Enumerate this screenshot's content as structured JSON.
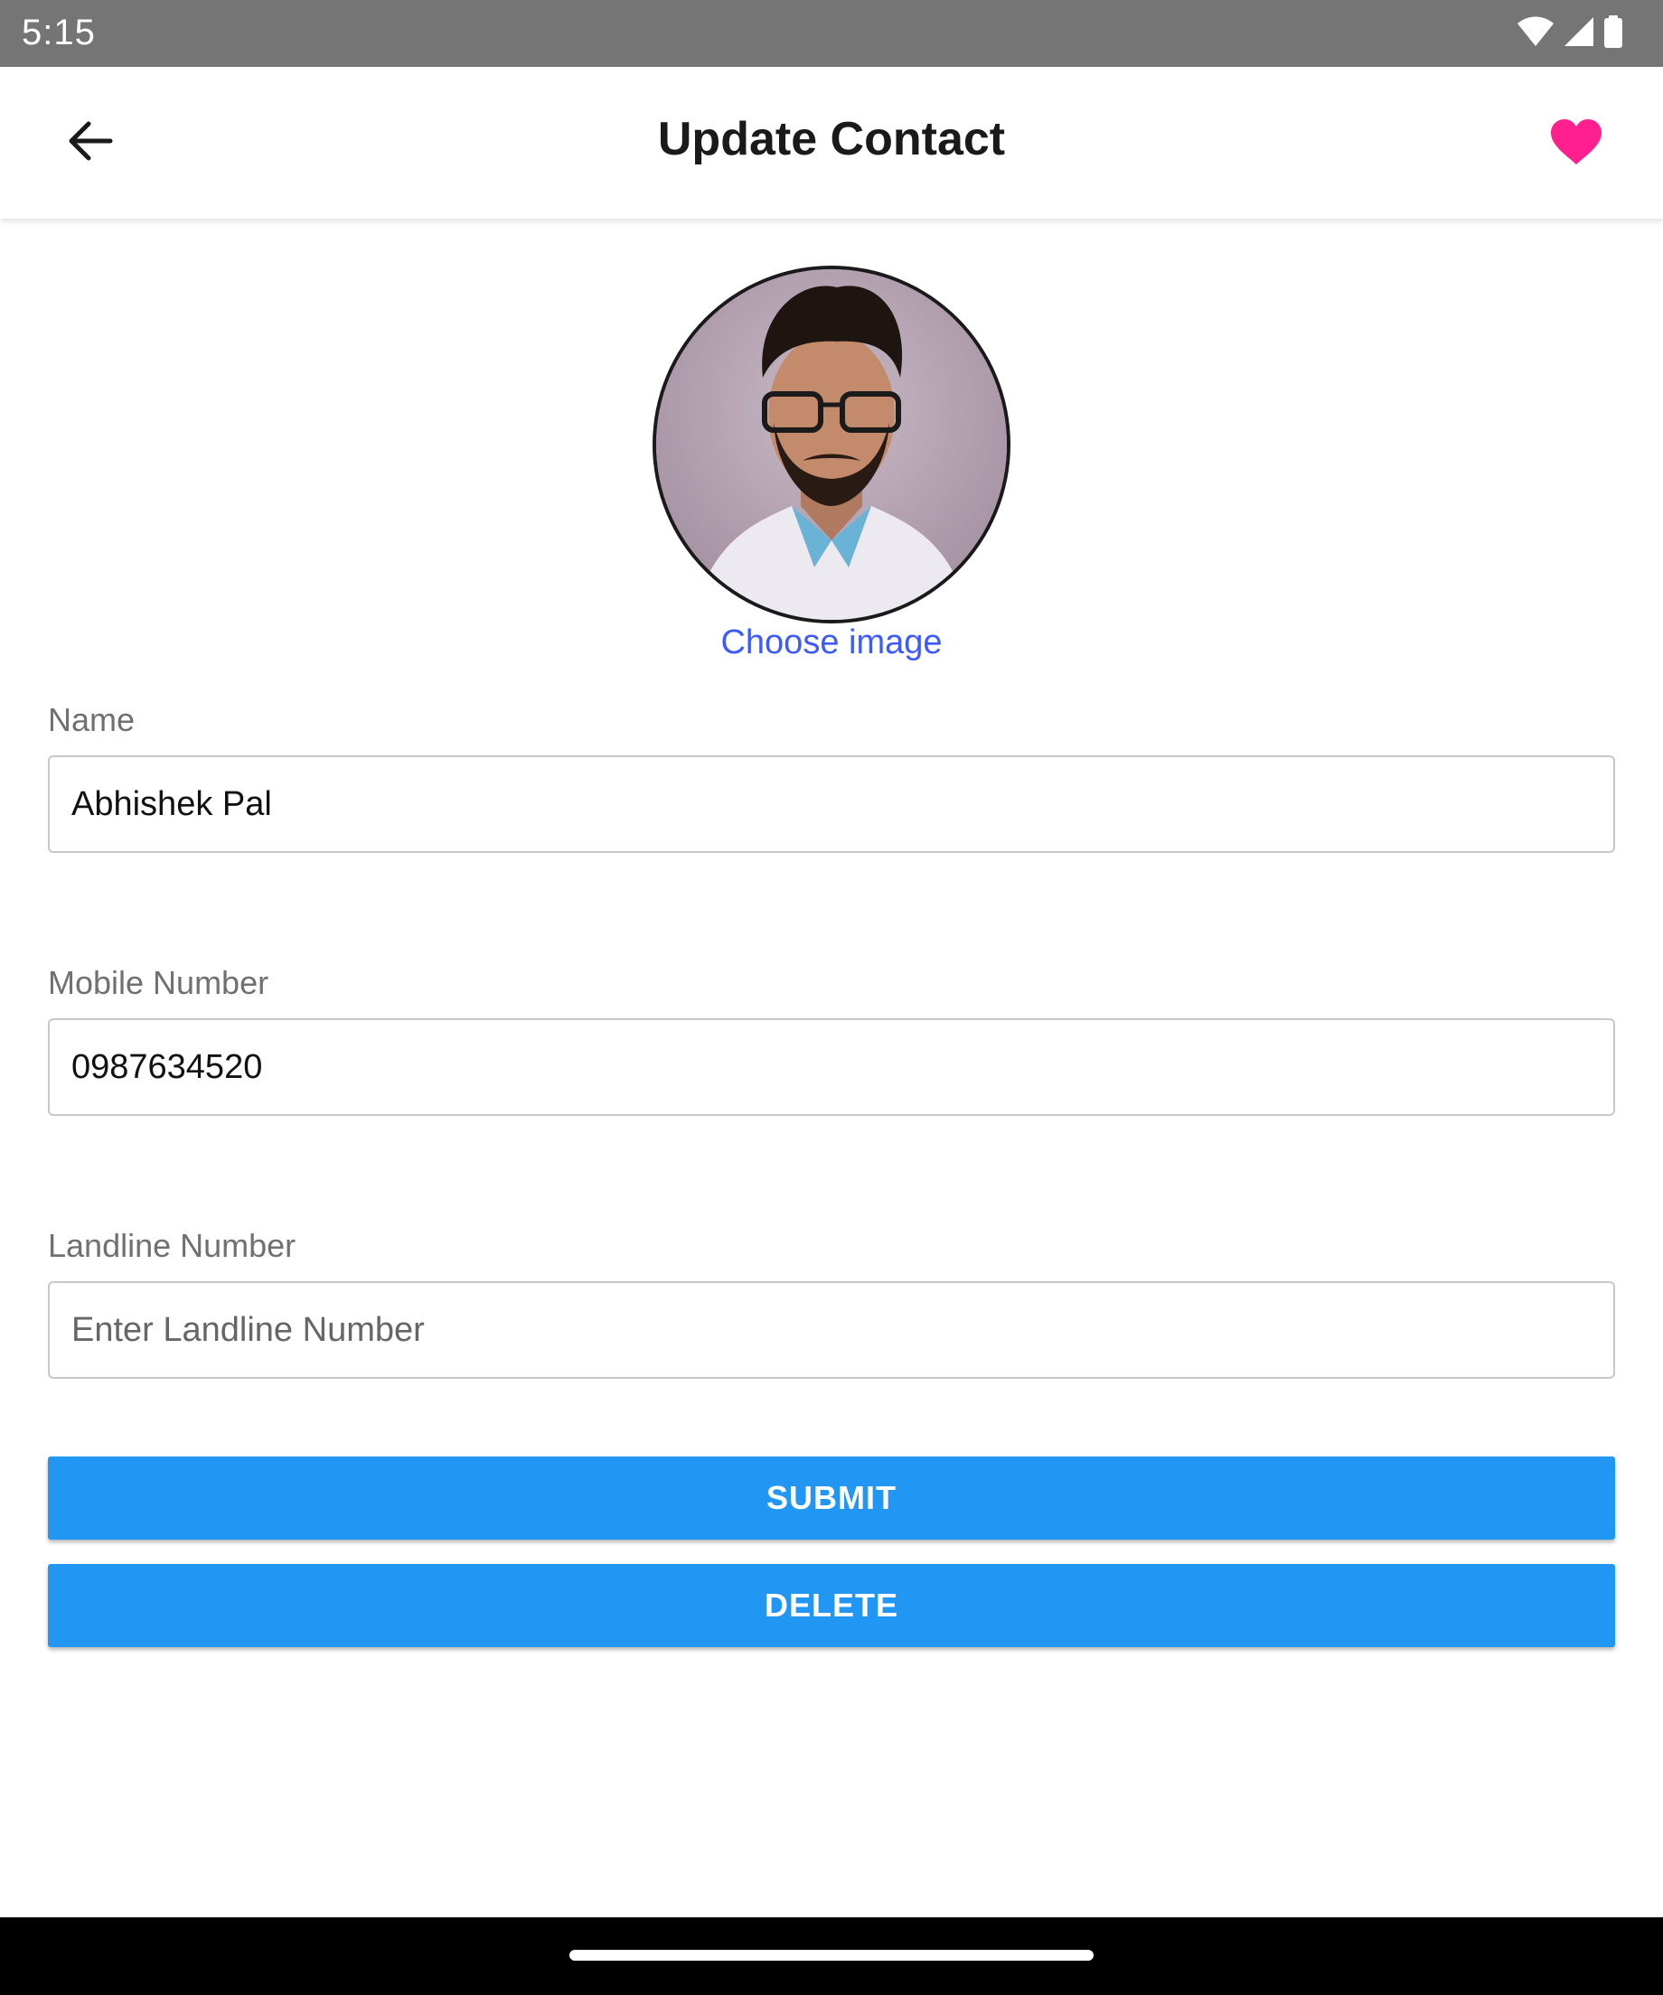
{
  "status_bar": {
    "time": "5:15",
    "icons": [
      "wifi-icon",
      "cellular-signal-icon",
      "battery-icon"
    ]
  },
  "app_bar": {
    "title": "Update Contact",
    "back_icon": "arrow-back-icon",
    "favorite_icon": "heart-icon",
    "favorite_color": "#ff1f8e"
  },
  "avatar": {
    "choose_image_label": "Choose image",
    "link_color": "#3d5afe"
  },
  "form": {
    "name": {
      "label": "Name",
      "value": "Abhishek Pal",
      "placeholder": ""
    },
    "mobile": {
      "label": "Mobile Number",
      "value": "0987634520",
      "placeholder": ""
    },
    "landline": {
      "label": "Landline Number",
      "value": "",
      "placeholder": "Enter Landline Number"
    }
  },
  "actions": {
    "submit_label": "SUBMIT",
    "delete_label": "DELETE",
    "button_color": "#2196f3"
  }
}
